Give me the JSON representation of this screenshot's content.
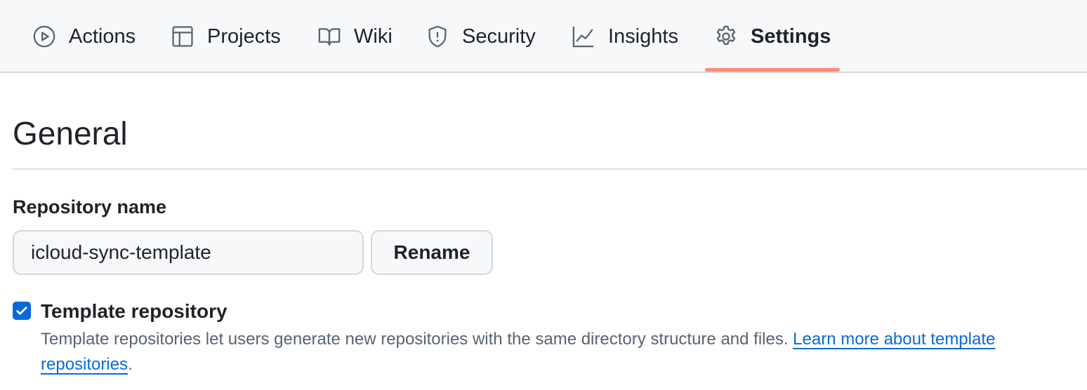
{
  "nav": {
    "tabs": [
      {
        "label": "Actions",
        "icon": "play-circle-icon"
      },
      {
        "label": "Projects",
        "icon": "table-icon"
      },
      {
        "label": "Wiki",
        "icon": "book-icon"
      },
      {
        "label": "Security",
        "icon": "shield-icon"
      },
      {
        "label": "Insights",
        "icon": "graph-icon"
      },
      {
        "label": "Settings",
        "icon": "gear-icon",
        "selected": true
      }
    ],
    "underline_color": "#fd8c73"
  },
  "main": {
    "title": "General",
    "repo_name_label": "Repository name",
    "repo_name_value": "icloud-sync-template",
    "rename_button": "Rename",
    "template_checkbox": {
      "label": "Template repository",
      "checked": true,
      "description": "Template repositories let users generate new repositories with the same directory structure and files.",
      "link_text": "Learn more about template repositories",
      "trailing": "."
    }
  },
  "colors": {
    "accent": "#0969da",
    "link": "#0969da"
  }
}
